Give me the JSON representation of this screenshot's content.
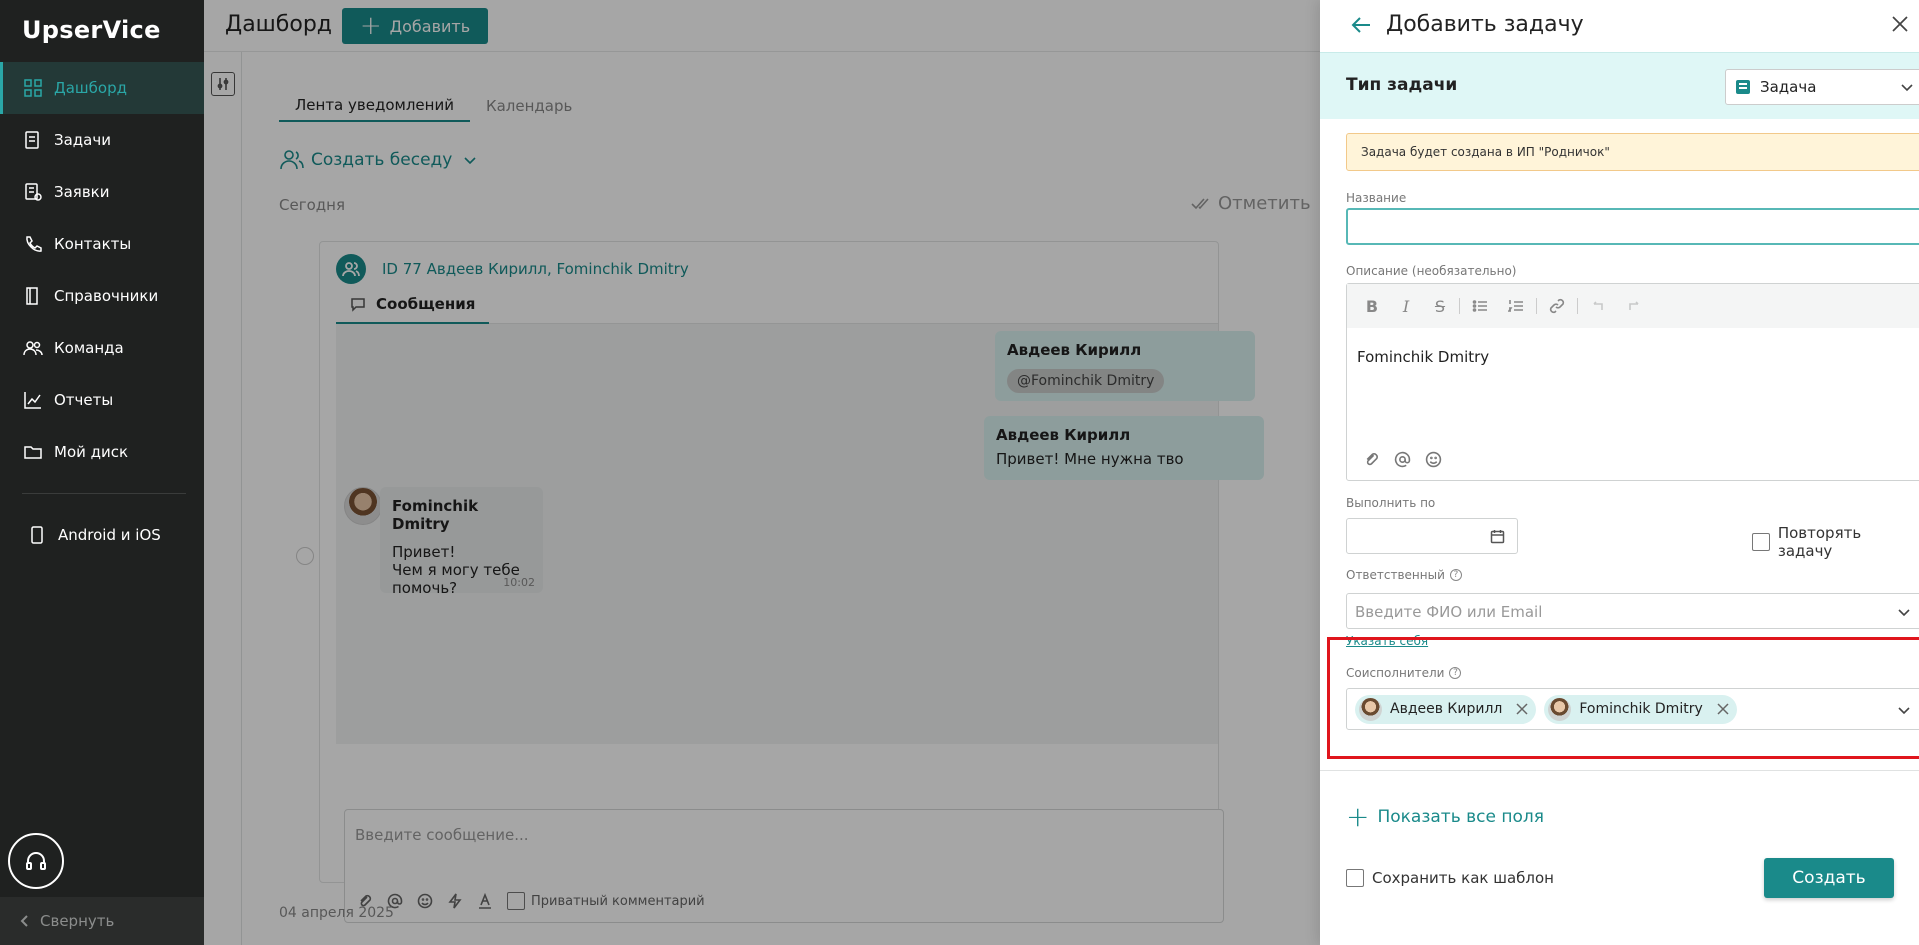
{
  "app": {
    "logo": "UpserVice"
  },
  "sidebar": {
    "items": [
      {
        "label": "Дашборд",
        "icon": "dashboard-icon",
        "active": true
      },
      {
        "label": "Задачи",
        "icon": "tasks-icon"
      },
      {
        "label": "Заявки",
        "icon": "requests-icon"
      },
      {
        "label": "Контакты",
        "icon": "phone-icon"
      },
      {
        "label": "Справочники",
        "icon": "book-icon"
      },
      {
        "label": "Команда",
        "icon": "team-icon"
      },
      {
        "label": "Отчеты",
        "icon": "chart-icon"
      },
      {
        "label": "Мой диск",
        "icon": "folder-icon"
      }
    ],
    "mobile": {
      "label": "Android и iOS",
      "icon": "phone-device-icon"
    },
    "collapse_label": "Свернуть"
  },
  "header": {
    "title": "Дашборд",
    "add_label": "Добавить"
  },
  "feed": {
    "tabs": [
      {
        "label": "Лента уведомлений",
        "active": true
      },
      {
        "label": "Календарь",
        "active": false
      }
    ],
    "create_chat_label": "Создать беседу",
    "today_label": "Сегодня",
    "mark_read_label": "Отметить",
    "date_divider": "04 апреля 2025"
  },
  "chat": {
    "title": "ID 77 Авдеев Кирилл, Fominchik Dmitry",
    "messages_tab": "Сообщения",
    "messages": [
      {
        "author": "Авдеев Кирилл",
        "text": "@Fominchik Dmitry"
      },
      {
        "author": "Авдеев Кирилл",
        "text": "Привет! Мне нужна тво"
      },
      {
        "author": "Fominchik Dmitry",
        "line1": "Привет!",
        "line2": "Чем я могу тебе помочь?",
        "time": "10:02"
      }
    ],
    "composer_placeholder": "Введите сообщение...",
    "private_comment_label": "Приватный комментарий"
  },
  "panel": {
    "title": "Добавить задачу",
    "type_label": "Тип задачи",
    "type_value": "Задача",
    "notice": "Задача будет создана в ИП \"Родничок\"",
    "name_label": "Название",
    "name_value": "",
    "description_label": "Описание (необязательно)",
    "description_text": "Fominchik Dmitry",
    "due_label": "Выполнить по",
    "repeat_label": "Повторять задачу",
    "responsible_label": "Ответственный",
    "responsible_placeholder": "Введите ФИО или Email",
    "self_link": "Указать себя",
    "coexecutors_label": "Соисполнители",
    "coexecutors": [
      {
        "name": "Авдеев Кирилл"
      },
      {
        "name": "Fominchik Dmitry"
      }
    ],
    "show_all_label": "Показать все поля",
    "save_template_label": "Сохранить как шаблон",
    "create_label": "Создать"
  },
  "colors": {
    "accent": "#1a8a8a",
    "sidebar": "#1f2120",
    "highlight": "#e0151d"
  }
}
